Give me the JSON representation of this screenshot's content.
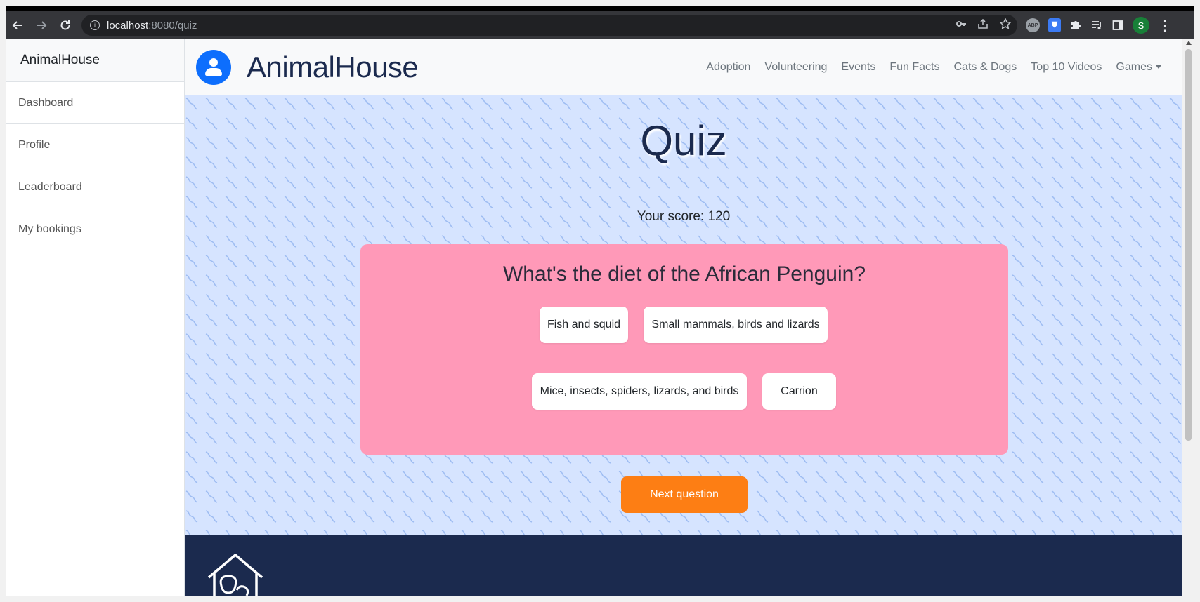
{
  "browser": {
    "url_host": "localhost",
    "url_path": ":8080/quiz"
  },
  "sidebar": {
    "title": "AnimalHouse",
    "items": [
      {
        "label": "Dashboard"
      },
      {
        "label": "Profile"
      },
      {
        "label": "Leaderboard"
      },
      {
        "label": "My bookings"
      }
    ]
  },
  "navbar": {
    "brand": "AnimalHouse",
    "links": [
      {
        "label": "Adoption"
      },
      {
        "label": "Volunteering"
      },
      {
        "label": "Events"
      },
      {
        "label": "Fun Facts"
      },
      {
        "label": "Cats & Dogs"
      },
      {
        "label": "Top 10 Videos"
      },
      {
        "label": "Games"
      }
    ]
  },
  "quiz": {
    "title": "Quiz",
    "score_text": "Your score: 120",
    "question": "What's the diet of the African Penguin?",
    "answers": [
      {
        "label": "Fish and squid"
      },
      {
        "label": "Small mammals, birds and lizards"
      },
      {
        "label": "Mice, insects, spiders, lizards, and birds"
      },
      {
        "label": "Carrion"
      }
    ],
    "next_label": "Next question"
  },
  "colors": {
    "accent": "#0d6efd",
    "card": "#ff99b8",
    "next_button": "#fd7e14",
    "footer": "#1b2a4e",
    "hero_bg": "#d6e4ff"
  },
  "icons": {
    "back": "arrow-left-icon",
    "forward": "arrow-right-icon",
    "reload": "reload-icon",
    "site_info": "info-icon",
    "key": "key-icon",
    "share": "share-icon",
    "bookmark": "star-icon",
    "extensions": "puzzle-icon",
    "footer_logo": "doghouse-icon"
  },
  "profile_initial": "S",
  "abp_label": "ABP"
}
